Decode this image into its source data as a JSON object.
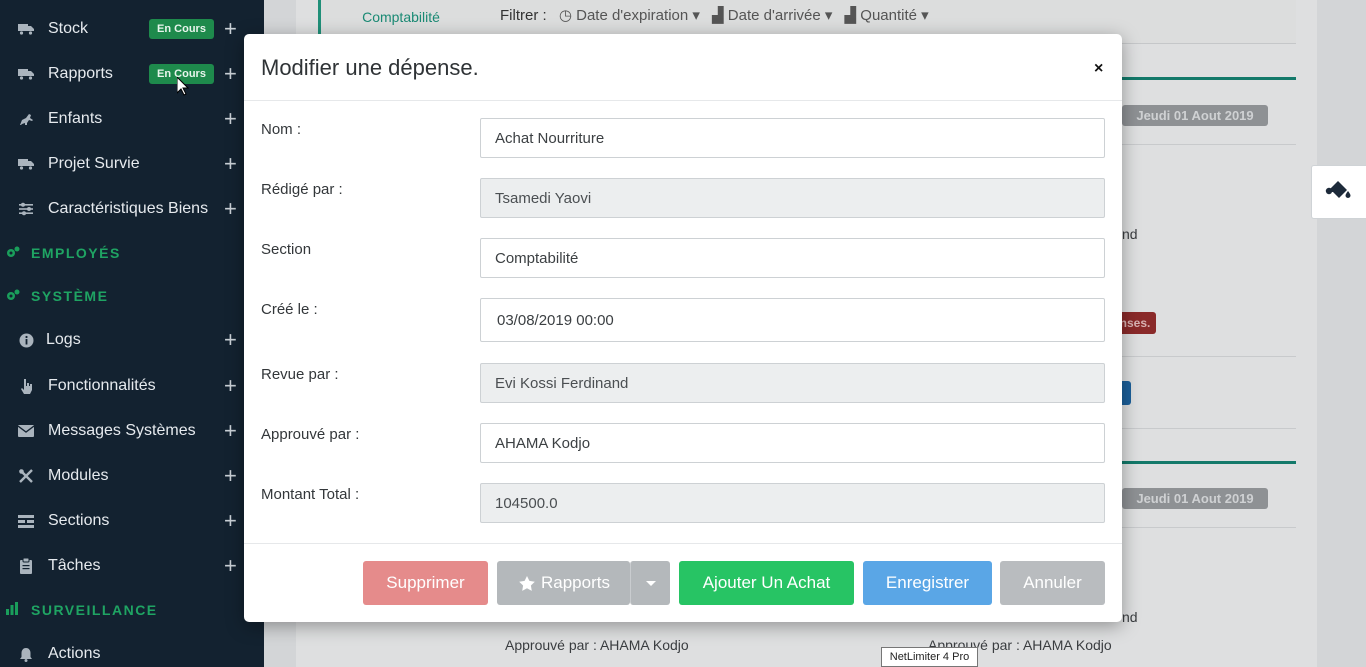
{
  "sidebar": {
    "items": [
      {
        "label": "Stock",
        "badge": "En Cours",
        "icon": "truck-icon"
      },
      {
        "label": "Rapports",
        "badge": "En Cours",
        "icon": "truck-icon"
      },
      {
        "label": "Enfants",
        "icon": "horse-icon"
      },
      {
        "label": "Projet Survie",
        "icon": "truck-icon"
      },
      {
        "label": "Caractéristiques Biens",
        "icon": "sliders-icon"
      }
    ],
    "section_employes": "EMPLOYÉS",
    "section_systeme": "SYSTÈME",
    "system_items": [
      {
        "label": "Logs",
        "icon": "info-icon"
      },
      {
        "label": "Fonctionnalités",
        "icon": "hand-pointer-icon"
      },
      {
        "label": "Messages Systèmes",
        "icon": "envelope-icon"
      },
      {
        "label": "Modules",
        "icon": "tools-icon"
      },
      {
        "label": "Sections",
        "icon": "grid-icon"
      },
      {
        "label": "Tâches",
        "icon": "clipboard-icon"
      }
    ],
    "section_surveillance": "SURVEILLANCE",
    "surveillance_items": [
      {
        "label": "Actions",
        "icon": "bell-icon"
      }
    ]
  },
  "background": {
    "active_tab": "Comptabilité",
    "filter_label": "Filtrer :",
    "filter_options": [
      "Date d'expiration",
      "Date d'arrivée",
      "Quantité"
    ],
    "date_badge_1": "Jeudi 01 Aout 2019",
    "date_badge_2": "Jeudi 01 Aout 2019",
    "fragment_nd_1": "nd",
    "fragment_nd_2": "nd",
    "fragment_red": "nses.",
    "approved_1": "Approuvé par : AHAMA Kodjo",
    "approved_2": "Approuvé par : AHAMA Kodjo",
    "reviewed_fragment": "Revue par : Evi Kossi Ferdinand"
  },
  "modal": {
    "title": "Modifier une dépense.",
    "close": "×",
    "fields": {
      "nom": {
        "label": "Nom :",
        "value": "Achat Nourriture"
      },
      "redige": {
        "label": "Rédigé par :",
        "value": "Tsamedi Yaovi"
      },
      "section": {
        "label": "Section",
        "value": "Comptabilité"
      },
      "cree": {
        "label": "Créé le :",
        "value": "03/08/2019 00:00"
      },
      "revue": {
        "label": "Revue par :",
        "value": "Evi Kossi Ferdinand"
      },
      "approuve": {
        "label": "Approuvé par :",
        "value": "AHAMA Kodjo"
      },
      "montant": {
        "label": "Montant Total :",
        "value": "104500.0"
      }
    },
    "buttons": {
      "delete": "Supprimer",
      "reports": "Rapports",
      "add_purchase": "Ajouter Un Achat",
      "save": "Enregistrer",
      "cancel": "Annuler"
    }
  },
  "tooltip": "NetLimiter 4 Pro",
  "colors": {
    "sidebar_bg": "#132230",
    "accent_green": "#1fa463",
    "badge_green": "#1e8a4c",
    "btn_delete": "#e58b8b",
    "btn_add": "#27c464",
    "btn_save": "#5aa6e6"
  }
}
